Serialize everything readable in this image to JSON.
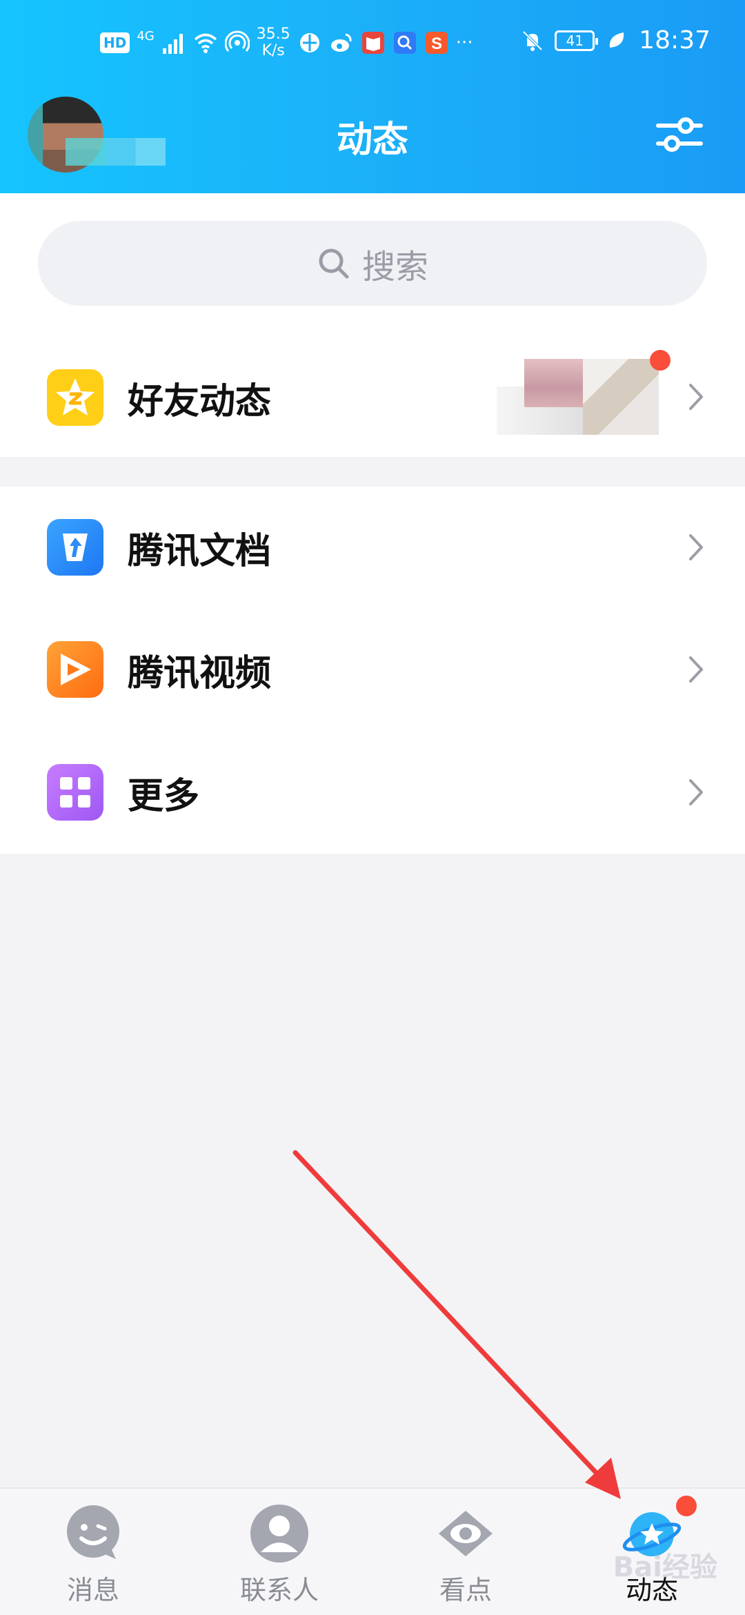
{
  "statusbar": {
    "hd": "HD",
    "net_gen": "4G",
    "speed_value": "35.5",
    "speed_unit": "K/s",
    "battery": "41",
    "time": "18:37"
  },
  "header": {
    "title": "动态"
  },
  "search": {
    "placeholder": "搜索"
  },
  "rows": [
    {
      "label": "好友动态",
      "icon": "qzone-star-icon",
      "color": "#ffcf18"
    },
    {
      "label": "腾讯文档",
      "icon": "tencent-docs-icon",
      "color": "#2e8cf4"
    },
    {
      "label": "腾讯视频",
      "icon": "tencent-video-icon",
      "color": "#ff8a1a"
    },
    {
      "label": "更多",
      "icon": "grid-more-icon",
      "color": "#b56af7"
    }
  ],
  "tabs": [
    {
      "label": "消息",
      "icon": "message-smile-icon"
    },
    {
      "label": "联系人",
      "icon": "contacts-icon"
    },
    {
      "label": "看点",
      "icon": "eye-icon"
    },
    {
      "label": "动态",
      "icon": "planet-star-icon",
      "active": true
    }
  ],
  "watermark": "Bai经验"
}
